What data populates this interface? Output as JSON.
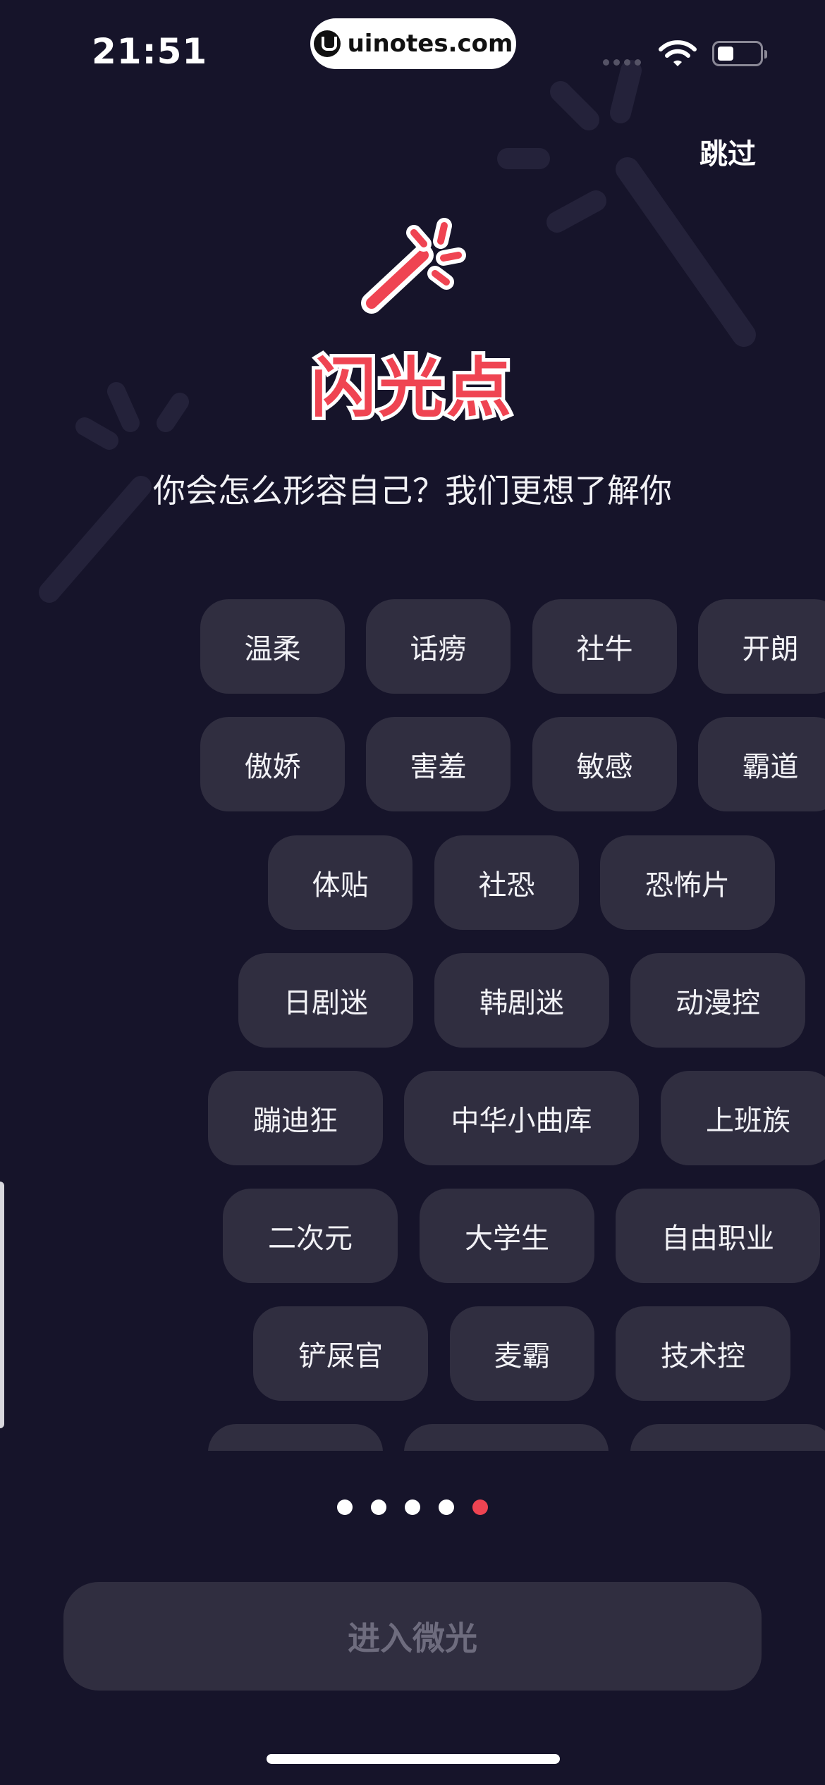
{
  "status_bar": {
    "time": "21:51",
    "url": "uinotes.com"
  },
  "header": {
    "skip_label": "跳过"
  },
  "brand": {
    "logo_text": "闪光点",
    "color": "#ef4452"
  },
  "subtitle": "你会怎么形容自己？我们更想了解你",
  "tags": [
    "温柔",
    "话痨",
    "社牛",
    "开朗",
    "傲娇",
    "害羞",
    "敏感",
    "霸道",
    "体贴",
    "社恐",
    "恐怖片",
    "日剧迷",
    "韩剧迷",
    "动漫控",
    "蹦迪狂",
    "中华小曲库",
    "上班族",
    "二次元",
    "大学生",
    "自由职业",
    "铲屎官",
    "麦霸",
    "技术控"
  ],
  "pagination": {
    "total": 5,
    "active_index": 4
  },
  "enter_button": {
    "label": "进入微光"
  },
  "colors": {
    "background": "#16142a",
    "tag_background": "#302e40",
    "accent": "#ef4452"
  }
}
